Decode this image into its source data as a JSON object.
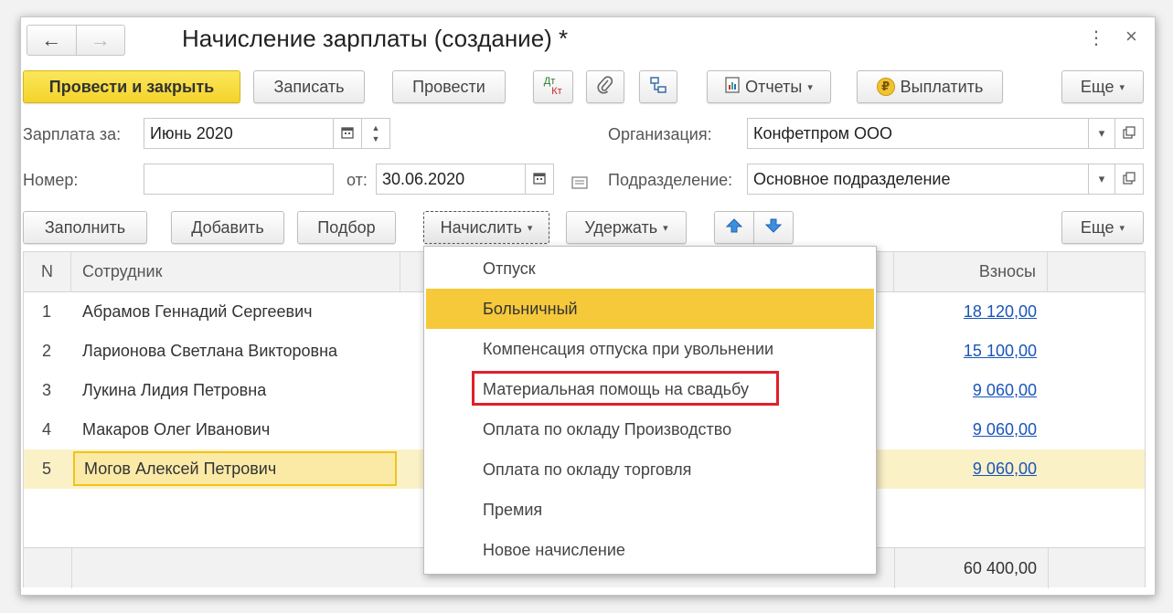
{
  "window": {
    "title": "Начисление зарплаты (создание) *"
  },
  "titlebar": {
    "back_icon": "←",
    "forward_icon": "→",
    "menu_icon": "⋮",
    "close_icon": "×"
  },
  "toolbar": {
    "post_close": "Провести и закрыть",
    "save": "Записать",
    "post": "Провести",
    "dtkt_top": "Дт",
    "dtkt_bottom": "Кт",
    "reports": "Отчеты",
    "pay": "Выплатить",
    "pay_icon": "₽",
    "more": "Еще"
  },
  "form": {
    "period_label": "Зарплата за:",
    "period_value": "Июнь 2020",
    "org_label": "Организация:",
    "org_value": "Конфетпром ООО",
    "number_label": "Номер:",
    "number_value": "",
    "date_label": "от:",
    "date_value": "30.06.2020",
    "division_label": "Подразделение:",
    "division_value": "Основное подразделение"
  },
  "table_toolbar": {
    "fill": "Заполнить",
    "add": "Добавить",
    "pick": "Подбор",
    "accrue": "Начислить",
    "withhold": "Удержать",
    "more": "Еще"
  },
  "table": {
    "columns": {
      "n": "N",
      "employee": "Сотрудник",
      "contributions": "Взносы"
    },
    "rows": [
      {
        "n": "1",
        "name": "Абрамов Геннадий Сергеевич",
        "contrib": "18 120,00"
      },
      {
        "n": "2",
        "name": "Ларионова Светлана Викторовна",
        "contrib": "15 100,00"
      },
      {
        "n": "3",
        "name": "Лукина Лидия Петровна",
        "contrib": "9 060,00"
      },
      {
        "n": "4",
        "name": "Макаров Олег Иванович",
        "contrib": "9 060,00"
      },
      {
        "n": "5",
        "name": "Могов Алексей Петрович",
        "contrib": "9 060,00"
      }
    ],
    "total_contributions": "60 400,00"
  },
  "dropdown": {
    "items": [
      "Отпуск",
      "Больничный",
      "Компенсация отпуска при увольнении",
      "Материальная помощь на свадьбу",
      "Оплата по окладу Производство",
      "Оплата по окладу торговля",
      "Премия",
      "Новое начисление"
    ],
    "highlighted_index": 1,
    "boxed_index": 3
  },
  "colors": {
    "primary": "#f4d32b",
    "highlight": "#f5c93a",
    "link": "#1b55b8",
    "mark": "#e0202a",
    "selected_row": "#fbf1c7"
  }
}
